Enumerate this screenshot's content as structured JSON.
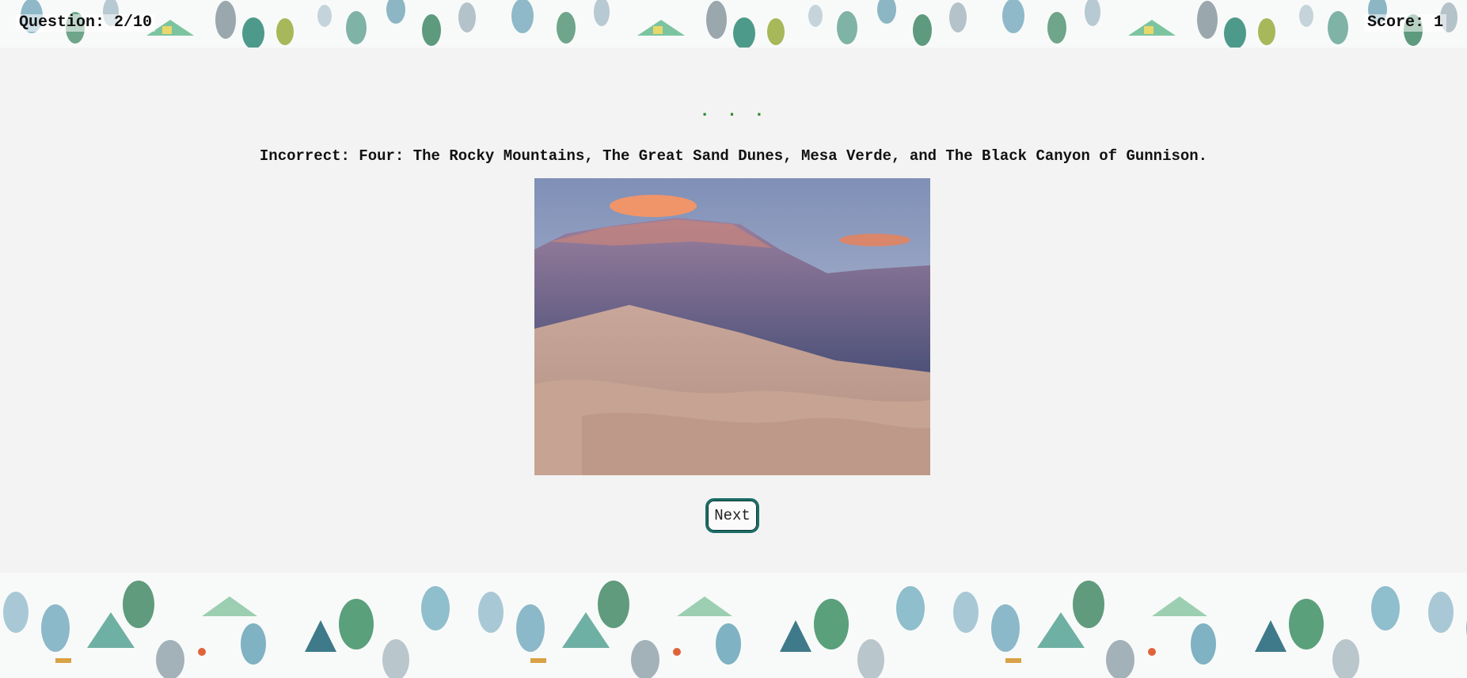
{
  "hud": {
    "question_label": "Question:",
    "question_value": "2/10",
    "score_label": "Score:",
    "score_value": "1"
  },
  "loading_dots": ". . .",
  "feedback": "Incorrect: Four: The Rocky Mountains, The Great Sand Dunes, Mesa Verde, and The Black Canyon of Gunnison.",
  "next_label": "Next",
  "colors": {
    "page_bg": "#f3f3f3",
    "dots": "#2e8b2e",
    "button_border": "#1b6c66"
  }
}
